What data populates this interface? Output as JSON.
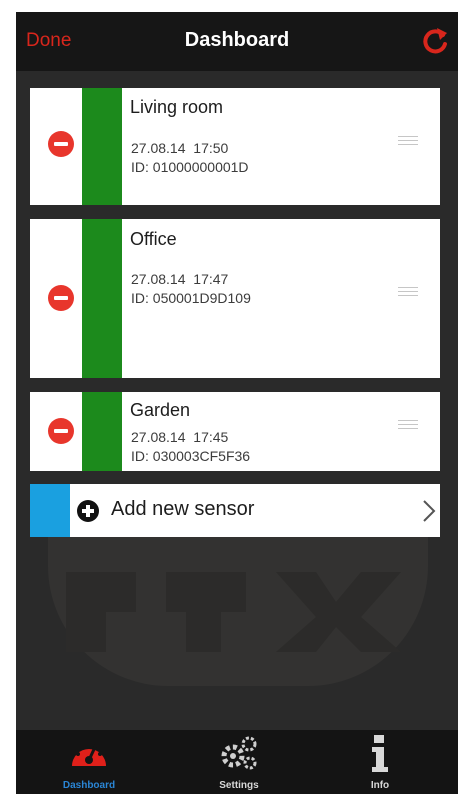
{
  "navbar": {
    "done_label": "Done",
    "title": "Dashboard",
    "refresh_icon": "refresh-icon"
  },
  "sensors": [
    {
      "name": "Living room",
      "date": "27.08.14",
      "time": "17:50",
      "id_label": "ID: 01000000001D",
      "status_color": "#1c8a1c"
    },
    {
      "name": "Office",
      "date": "27.08.14",
      "time": "17:47",
      "id_label": "ID: 050001D9D109",
      "status_color": "#1c8a1c"
    },
    {
      "name": "Garden",
      "date": "27.08.14",
      "time": "17:45",
      "id_label": "ID: 030003CF5F36",
      "status_color": "#1c8a1c"
    }
  ],
  "add_sensor": {
    "label": "Add new sensor",
    "accent_color": "#1aa0e0"
  },
  "tabs": [
    {
      "label": "Dashboard",
      "icon": "speedometer-icon",
      "active": true
    },
    {
      "label": "Settings",
      "icon": "gears-icon",
      "active": false
    },
    {
      "label": "Info",
      "icon": "info-icon",
      "active": false
    }
  ],
  "colors": {
    "accent_red": "#d8261c",
    "background": "#2a2a2a",
    "active_tab": "#2a86d6"
  }
}
